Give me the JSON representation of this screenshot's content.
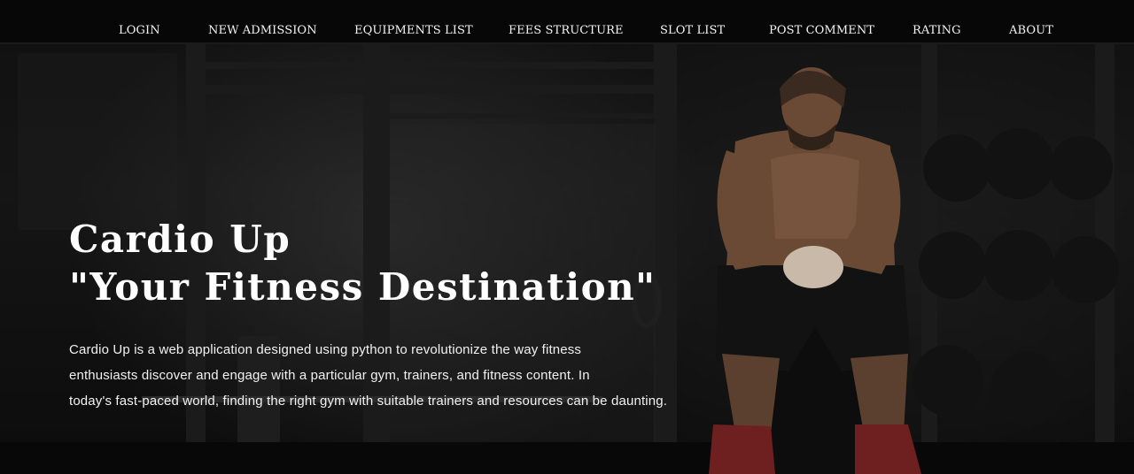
{
  "nav": {
    "items": [
      {
        "label": "LOGIN"
      },
      {
        "label": "NEW ADMISSION"
      },
      {
        "label": "EQUIPMENTS LIST"
      },
      {
        "label": "FEES STRUCTURE"
      },
      {
        "label": "SLOT LIST"
      },
      {
        "label": "POST COMMENT"
      },
      {
        "label": "RATING"
      },
      {
        "label": "ABOUT"
      }
    ]
  },
  "hero": {
    "title_line1": "Cardio Up",
    "title_line2": "\"Your Fitness Destination\"",
    "description_lines": [
      "Cardio Up is a web application designed using python to revolutionize the way fitness",
      "enthusiasts discover and engage with a particular gym, trainers, and fitness content. In",
      "today's fast-paced world, finding the right gym with suitable trainers and resources can be daunting."
    ]
  },
  "colors": {
    "nav_background": "#070707",
    "text": "#ffffff",
    "page_background": "#0b0b0b"
  }
}
